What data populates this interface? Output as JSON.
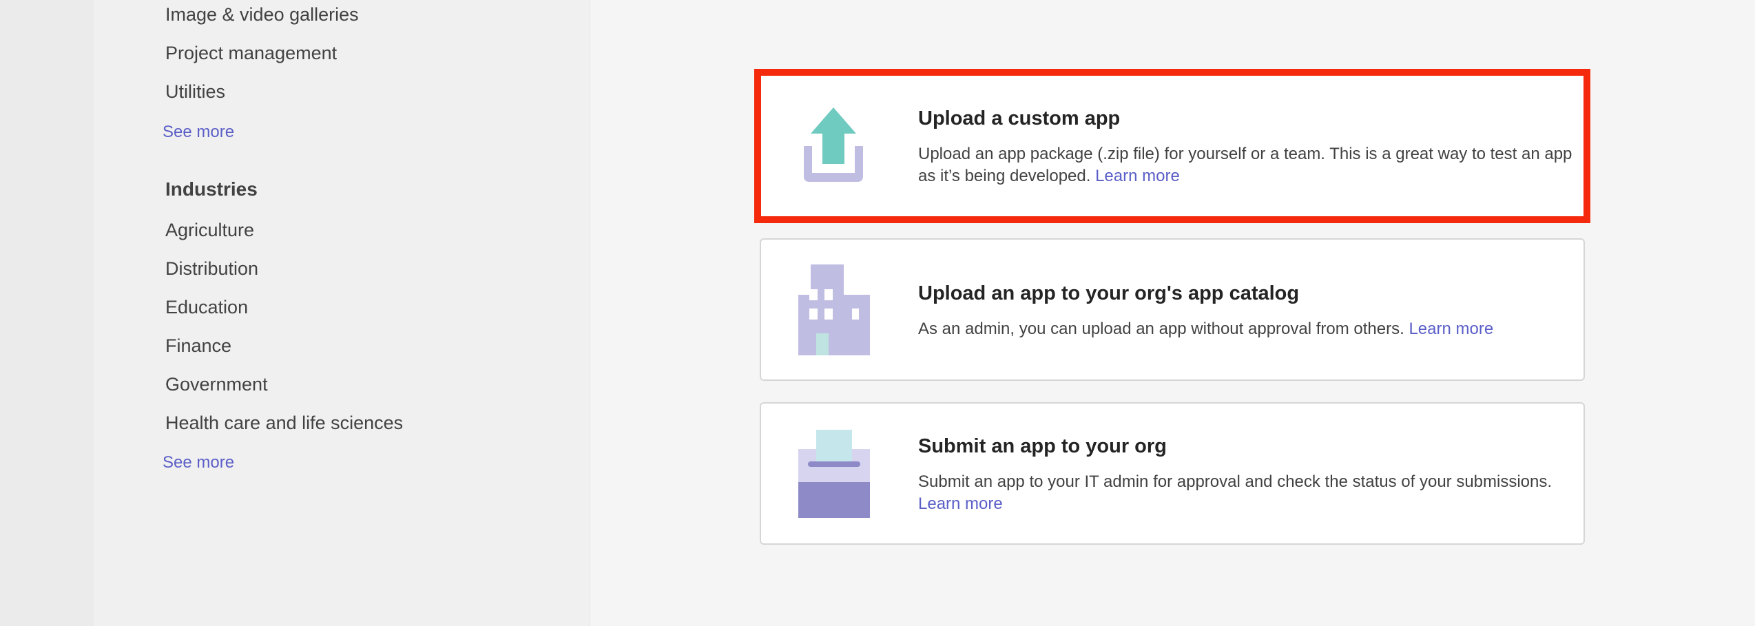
{
  "sidebar": {
    "categories": [
      {
        "label": "Image & video galleries"
      },
      {
        "label": "Project management"
      },
      {
        "label": "Utilities"
      }
    ],
    "categories_see_more": "See more",
    "industries_heading": "Industries",
    "industries": [
      {
        "label": "Agriculture"
      },
      {
        "label": "Distribution"
      },
      {
        "label": "Education"
      },
      {
        "label": "Finance"
      },
      {
        "label": "Government"
      },
      {
        "label": "Health care and life sciences"
      }
    ],
    "industries_see_more": "See more"
  },
  "cards": [
    {
      "icon": "upload-icon",
      "title": "Upload a custom app",
      "description": "Upload an app package (.zip file) for yourself or a team. This is a great way to test an app as it’s being developed.",
      "link": "Learn more",
      "highlighted": true
    },
    {
      "icon": "building-icon",
      "title": "Upload an app to your org's app catalog",
      "description": "As an admin, you can upload an app without approval from others.",
      "link": "Learn more"
    },
    {
      "icon": "submit-box-icon",
      "title": "Submit an app to your org",
      "description": "Submit an app to your IT admin for approval and check the status of your submissions.",
      "link": "Learn more"
    }
  ],
  "colors": {
    "accent": "#5b5fc7",
    "highlight_border": "#f52a0d",
    "icon_lavender": "#c0bde3",
    "icon_teal": "#6fcac0",
    "icon_purple_dark": "#8d8ac7"
  }
}
